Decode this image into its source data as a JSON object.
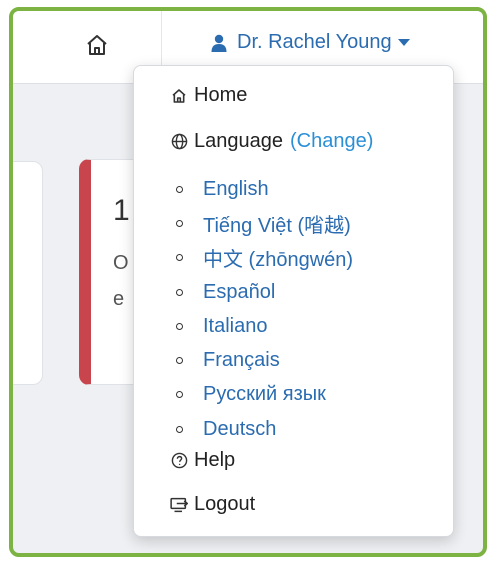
{
  "colors": {
    "frame_border": "#7cb342",
    "link": "#2b6cb0",
    "change": "#2b8fd6",
    "card_accent": "#c9454d"
  },
  "topbar": {
    "home_icon": "home-icon",
    "user_name": "Dr. Rachel Young",
    "user_icon": "person-icon",
    "caret_icon": "caret-down-icon"
  },
  "background_card": {
    "big_text": "1",
    "line1": "O",
    "line2": "e"
  },
  "dropdown": {
    "home": {
      "icon": "home-icon",
      "label": "Home"
    },
    "language": {
      "icon": "globe-icon",
      "label": "Language",
      "change_label": "(Change)"
    },
    "languages": [
      "English",
      "Tiếng Việt (㗂越)",
      "中文 (zhōngwén)",
      "Español",
      "Italiano",
      "Français",
      "Русский язык",
      "Deutsch"
    ],
    "help": {
      "icon": "help-circle-icon",
      "label": "Help"
    },
    "logout": {
      "icon": "logout-icon",
      "label": "Logout"
    }
  }
}
